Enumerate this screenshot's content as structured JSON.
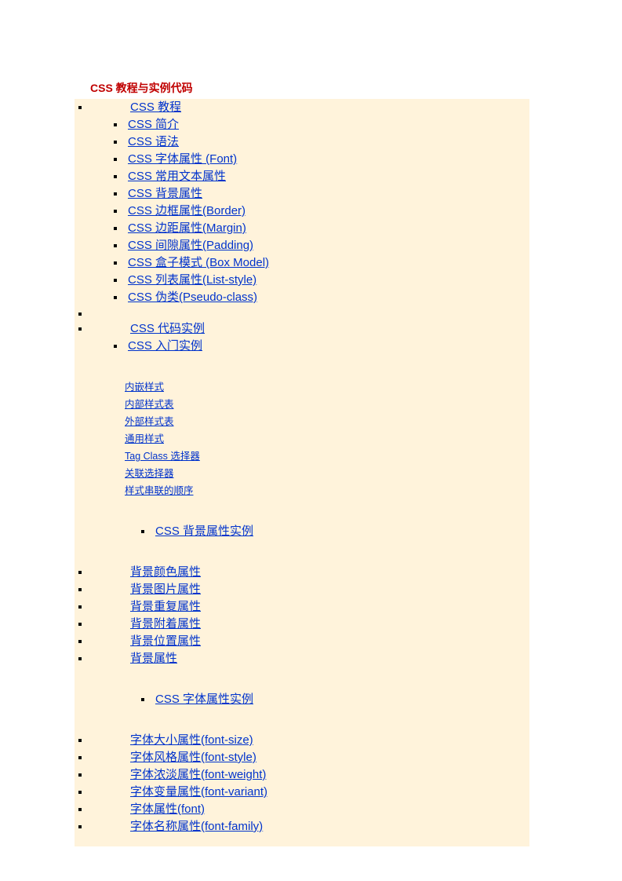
{
  "title": "CSS 教程与实例代码",
  "sec1_head": "CSS 教程",
  "sec1_items": [
    "CSS 简介",
    "CSS 语法",
    "CSS 字体属性 (Font)",
    "CSS 常用文本属性",
    "CSS 背景属性",
    "CSS 边框属性(Border)",
    "CSS 边距属性(Margin)",
    "CSS 间隙属性(Padding)",
    "CSS 盒子模式 (Box Model)",
    "CSS 列表属性(List-style)",
    "CSS 伪类(Pseudo-class)"
  ],
  "sec2_head": "CSS 代码实例",
  "sec2_sub1": "CSS 入门实例",
  "sec2_sub1_items": [
    "内嵌样式",
    "内部样式表",
    "外部样式表",
    "通用样式",
    "Tag Class 选择器",
    "关联选择器",
    "样式串联的顺序"
  ],
  "sec2_sub2": "CSS 背景属性实例",
  "sec2_sub2_items": [
    "背景颜色属性",
    "背景图片属性",
    "背景重复属性",
    "背景附着属性",
    "背景位置属性",
    "背景属性"
  ],
  "sec2_sub3": "CSS 字体属性实例",
  "sec2_sub3_items": [
    "字体大小属性(font-size)",
    "字体风格属性(font-style)",
    "字体浓淡属性(font-weight)",
    "字体变量属性(font-variant)",
    "字体属性(font)",
    "字体名称属性(font-family)"
  ]
}
